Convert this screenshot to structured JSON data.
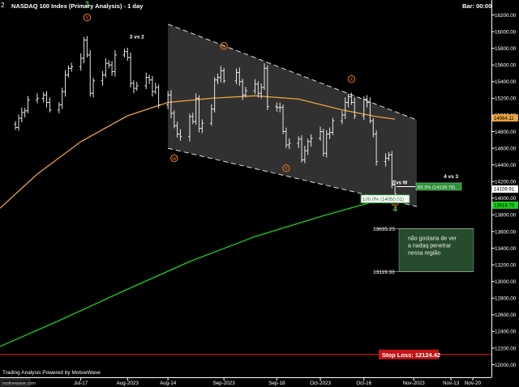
{
  "header": {
    "title": "NASDAQ 100 Index (Primary Analysis) - 1 day",
    "prefix": "2",
    "bar_label": "Bar: 00:00"
  },
  "footer": {
    "powered_by": "Trading Analysis Powered by MotiveWave",
    "watermark": "motivewave.com"
  },
  "colors": {
    "background": "#000000",
    "bars": "#e6e6e6",
    "sma_fast": "#e8a33c",
    "sma_slow": "#19d11c",
    "channel_fill": "#5a5a5a",
    "stop_line": "#c41414",
    "wave_label": "#f07a22",
    "wave_green": "#3ed13c",
    "callout_fill": "#274c2d"
  },
  "chart_data": {
    "type": "ohlc",
    "symbol": "NASDAQ 100 Index",
    "timeframe": "1 day",
    "ylim": [
      11850,
      16380
    ],
    "y_ticks": [
      12000,
      12200,
      12400,
      12600,
      12800,
      13000,
      13200,
      13400,
      13600,
      13800,
      14000,
      14200,
      14400,
      14600,
      14800,
      15000,
      15200,
      15400,
      15600,
      15800,
      16000,
      16200
    ],
    "x_ticks": [
      "Jul-17",
      "Aug-2023",
      "Aug-14",
      "Sep-2023",
      "Sep-18",
      "Oct-2023",
      "Oct-16",
      "Nov-2023",
      "Nov-13",
      "Nov-20"
    ],
    "x_tick_dates": [
      "2023-07-17",
      "2023-08-01",
      "2023-08-14",
      "2023-09-01",
      "2023-09-18",
      "2023-10-02",
      "2023-10-16",
      "2023-11-01",
      "2023-11-13",
      "2023-11-20"
    ],
    "x_range": [
      "2023-06-21",
      "2023-11-26"
    ],
    "dates": [
      "2023-06-26",
      "2023-06-27",
      "2023-06-28",
      "2023-06-29",
      "2023-06-30",
      "2023-07-03",
      "2023-07-05",
      "2023-07-06",
      "2023-07-07",
      "2023-07-10",
      "2023-07-11",
      "2023-07-12",
      "2023-07-13",
      "2023-07-14",
      "2023-07-17",
      "2023-07-18",
      "2023-07-19",
      "2023-07-20",
      "2023-07-21",
      "2023-07-24",
      "2023-07-25",
      "2023-07-26",
      "2023-07-27",
      "2023-07-28",
      "2023-07-31",
      "2023-08-01",
      "2023-08-02",
      "2023-08-03",
      "2023-08-04",
      "2023-08-07",
      "2023-08-08",
      "2023-08-09",
      "2023-08-10",
      "2023-08-11",
      "2023-08-14",
      "2023-08-15",
      "2023-08-16",
      "2023-08-17",
      "2023-08-18",
      "2023-08-21",
      "2023-08-22",
      "2023-08-23",
      "2023-08-24",
      "2023-08-25",
      "2023-08-28",
      "2023-08-29",
      "2023-08-30",
      "2023-08-31",
      "2023-09-01",
      "2023-09-05",
      "2023-09-06",
      "2023-09-07",
      "2023-09-08",
      "2023-09-11",
      "2023-09-12",
      "2023-09-13",
      "2023-09-14",
      "2023-09-15",
      "2023-09-18",
      "2023-09-19",
      "2023-09-20",
      "2023-09-21",
      "2023-09-22",
      "2023-09-25",
      "2023-09-26",
      "2023-09-27",
      "2023-09-28",
      "2023-09-29",
      "2023-10-02",
      "2023-10-03",
      "2023-10-04",
      "2023-10-05",
      "2023-10-06",
      "2023-10-09",
      "2023-10-10",
      "2023-10-11",
      "2023-10-12",
      "2023-10-13",
      "2023-10-16",
      "2023-10-17",
      "2023-10-18",
      "2023-10-19",
      "2023-10-20",
      "2023-10-23",
      "2023-10-24",
      "2023-10-25",
      "2023-10-26"
    ],
    "close": [
      14850,
      14960,
      15030,
      15050,
      15180,
      15200,
      15240,
      15150,
      15060,
      15120,
      15280,
      15480,
      15560,
      15580,
      15680,
      15900,
      15720,
      15260,
      15410,
      15480,
      15620,
      15600,
      15520,
      15720,
      15760,
      15690,
      15380,
      15320,
      15350,
      15450,
      15420,
      15280,
      15330,
      15120,
      15240,
      15020,
      14870,
      14770,
      14740,
      14980,
      14920,
      15200,
      14840,
      14900,
      15070,
      15420,
      15450,
      15530,
      15410,
      15510,
      15400,
      15240,
      15290,
      15370,
      15260,
      15330,
      15560,
      15100,
      15090,
      15090,
      14800,
      14640,
      14660,
      14710,
      14460,
      14570,
      14680,
      14720,
      14800,
      14540,
      14770,
      14790,
      14930,
      15000,
      15150,
      15220,
      15150,
      14990,
      15190,
      15150,
      14930,
      14770,
      14440,
      14480,
      14520,
      14160,
      14050
    ],
    "sma_fast": [
      {
        "date": "2023-06-21",
        "value": 13880
      },
      {
        "date": "2023-07-03",
        "value": 14290
      },
      {
        "date": "2023-07-17",
        "value": 14680
      },
      {
        "date": "2023-08-01",
        "value": 14990
      },
      {
        "date": "2023-08-14",
        "value": 15150
      },
      {
        "date": "2023-08-28",
        "value": 15200
      },
      {
        "date": "2023-09-11",
        "value": 15230
      },
      {
        "date": "2023-09-25",
        "value": 15190
      },
      {
        "date": "2023-10-09",
        "value": 15060
      },
      {
        "date": "2023-10-20",
        "value": 14980
      },
      {
        "date": "2023-10-26",
        "value": 14950
      }
    ],
    "sma_slow": [
      {
        "date": "2023-06-21",
        "value": 12220
      },
      {
        "date": "2023-07-10",
        "value": 12530
      },
      {
        "date": "2023-07-31",
        "value": 12890
      },
      {
        "date": "2023-08-21",
        "value": 13240
      },
      {
        "date": "2023-09-11",
        "value": 13540
      },
      {
        "date": "2023-10-02",
        "value": 13780
      },
      {
        "date": "2023-10-23",
        "value": 14000
      },
      {
        "date": "2023-10-26",
        "value": 14030
      }
    ],
    "channel": {
      "upper": [
        {
          "date": "2023-08-14",
          "value": 16090
        },
        {
          "date": "2023-11-02",
          "value": 14940
        }
      ],
      "lower": [
        {
          "date": "2023-08-14",
          "value": 14600
        },
        {
          "date": "2023-11-02",
          "value": 13900
        }
      ]
    },
    "wave_labels": [
      {
        "text": "3",
        "date": "2023-07-19",
        "value": 16300,
        "style": "green"
      },
      {
        "text": "Y",
        "date": "2023-07-19",
        "value": 16170,
        "style": "circle"
      },
      {
        "text": "3 vs 2",
        "date": "2023-08-04",
        "value": 15920,
        "style": "plain"
      },
      {
        "text": "X",
        "date": "2023-09-01",
        "value": 15830,
        "style": "circle"
      },
      {
        "text": "W",
        "date": "2023-08-16",
        "value": 14480,
        "style": "circle"
      },
      {
        "text": "Y",
        "date": "2023-09-21",
        "value": 14360,
        "style": "circle"
      },
      {
        "text": "X",
        "date": "2023-10-12",
        "value": 15430,
        "style": "circle"
      },
      {
        "text": "Z",
        "date": "2023-10-26",
        "value": 13950,
        "style": "circle"
      },
      {
        "text": "4",
        "date": "2023-10-26",
        "value": 13840,
        "style": "green"
      },
      {
        "text": "4 vs 3",
        "date": "2023-11-13",
        "value": 14240,
        "style": "plain"
      }
    ],
    "annotations": {
      "z_vs_w": {
        "label": "Z vs W",
        "pct": "83.3%",
        "value": "14139.70"
      },
      "pct_100": {
        "label": "100.0%",
        "value": "14050.01"
      },
      "last_price_tag": "14109.91",
      "sma_fast_tag": "14964.11",
      "sma_slow_tag": "13916.70",
      "zone_top": 13635.25,
      "zone_bottom": 13119.33,
      "zone_text": "não gostaria de ver a nadaq penetrar nessa região",
      "stop_label": "Stop Loss:",
      "stop_value": 12124.42
    }
  }
}
